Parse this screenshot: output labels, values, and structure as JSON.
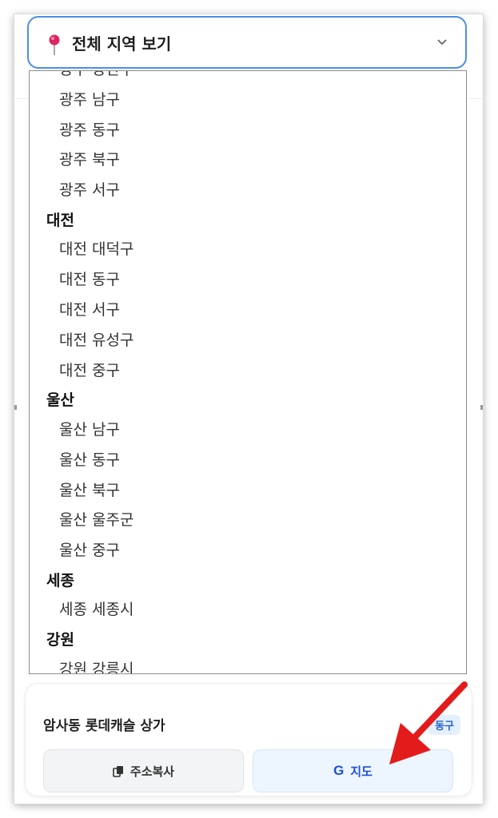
{
  "dropdown": {
    "selected_label": "전체 지역 보기",
    "pin_icon": "map-pin-icon",
    "chevron_icon": "chevron-down-icon"
  },
  "list": [
    {
      "type": "option",
      "label": "광주 광산구"
    },
    {
      "type": "option",
      "label": "광주 남구"
    },
    {
      "type": "option",
      "label": "광주 동구"
    },
    {
      "type": "option",
      "label": "광주 북구"
    },
    {
      "type": "option",
      "label": "광주 서구"
    },
    {
      "type": "group",
      "label": "대전"
    },
    {
      "type": "option",
      "label": "대전 대덕구"
    },
    {
      "type": "option",
      "label": "대전 동구"
    },
    {
      "type": "option",
      "label": "대전 서구"
    },
    {
      "type": "option",
      "label": "대전 유성구"
    },
    {
      "type": "option",
      "label": "대전 중구"
    },
    {
      "type": "group",
      "label": "울산"
    },
    {
      "type": "option",
      "label": "울산 남구"
    },
    {
      "type": "option",
      "label": "울산 동구"
    },
    {
      "type": "option",
      "label": "울산 북구"
    },
    {
      "type": "option",
      "label": "울산 울주군"
    },
    {
      "type": "option",
      "label": "울산 중구"
    },
    {
      "type": "group",
      "label": "세종"
    },
    {
      "type": "option",
      "label": "세종 세종시"
    },
    {
      "type": "group",
      "label": "강원"
    },
    {
      "type": "option",
      "label": "강원 강릉시"
    }
  ],
  "card": {
    "title": "암사동 롯데캐슬 상가",
    "badge": "동구",
    "copy_icon": "copy-icon",
    "copy_label": "주소복사",
    "map_icon": "google-g-icon",
    "map_glyph": "G",
    "map_label": "지도"
  },
  "annotation": {
    "icon": "red-arrow-icon",
    "color": "#e31b1b"
  },
  "colors": {
    "accent_border": "#4a8ee9",
    "map_text": "#1d4fd8",
    "pin": "#e0245e"
  }
}
